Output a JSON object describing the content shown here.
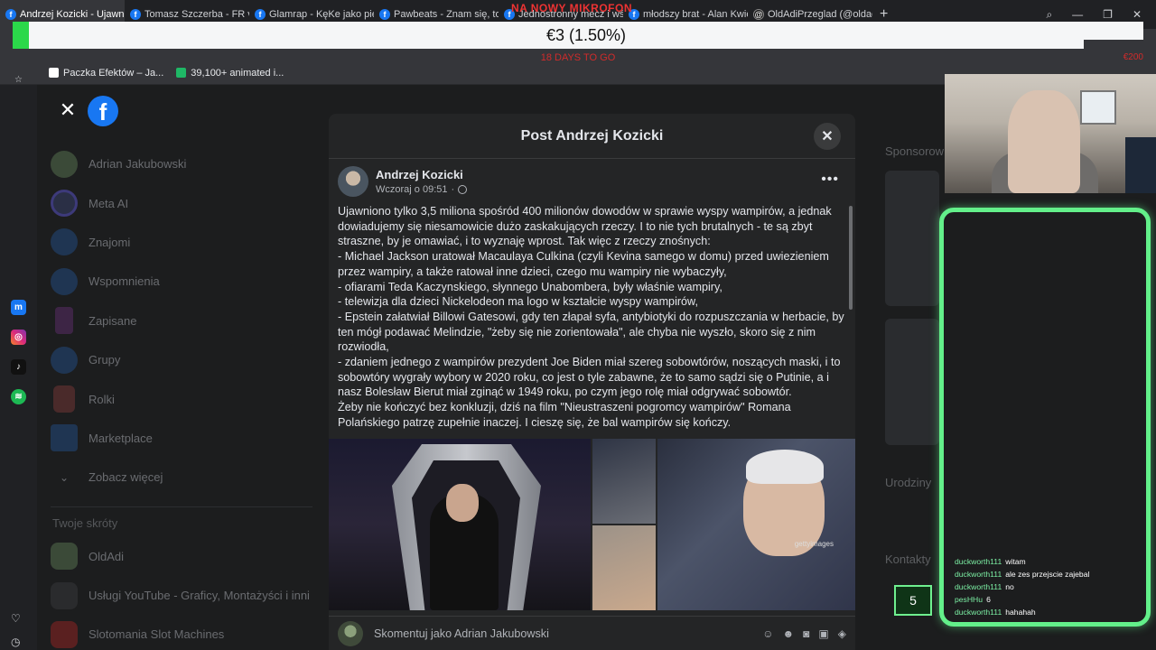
{
  "browser": {
    "tabs": [
      {
        "label": "Andrzej Kozicki - Ujawnio",
        "active": true
      },
      {
        "label": "Tomasz Szczerba - FR vs",
        "active": false
      },
      {
        "label": "Glamrap - KęKe jako pierw",
        "active": false
      },
      {
        "label": "Pawbeats - Znam się, to",
        "active": false
      },
      {
        "label": "Jednostronny mecz i wści",
        "active": false
      },
      {
        "label": "młodszy brat - Alan Kwiec",
        "active": false
      },
      {
        "label": "OldAdiPrzeglad (@oldadi",
        "active": false
      }
    ],
    "new_tab": "+",
    "window_controls": [
      "search",
      "minimize",
      "restore",
      "close"
    ],
    "bookmarks": [
      {
        "label": "Paczka Efektów – Ja...",
        "color": "#ffffff"
      },
      {
        "label": "39,100+ animated i...",
        "color": "#1fb866"
      }
    ]
  },
  "overlay": {
    "mic_title": "NA NOWY MIKROFON",
    "donation_amount": "€3 (1.50%)",
    "days_to_go": "18 DAYS TO GO",
    "side_amount": "€200",
    "accent_color": "#2bd84a"
  },
  "rail": {
    "icons": [
      "messenger-icon",
      "instagram-icon",
      "tiktok-icon",
      "spotify-icon"
    ],
    "bottom_icons": [
      "heart-icon",
      "history-icon"
    ]
  },
  "facebook": {
    "sidebar": {
      "items": [
        {
          "label": "Adrian Jakubowski",
          "icon": "profile-avatar"
        },
        {
          "label": "Meta AI",
          "icon": "meta-ai-icon"
        },
        {
          "label": "Znajomi",
          "icon": "friends-icon"
        },
        {
          "label": "Wspomnienia",
          "icon": "memories-icon"
        },
        {
          "label": "Zapisane",
          "icon": "saved-icon"
        },
        {
          "label": "Grupy",
          "icon": "groups-icon"
        },
        {
          "label": "Rolki",
          "icon": "reels-icon"
        },
        {
          "label": "Marketplace",
          "icon": "marketplace-icon"
        },
        {
          "label": "Zobacz więcej",
          "icon": "chevron-down-icon"
        }
      ],
      "shortcuts_title": "Twoje skróty",
      "shortcuts": [
        {
          "label": "OldAdi"
        },
        {
          "label": "Usługi YouTube - Graficy, Montażyści i inni"
        },
        {
          "label": "Slotomania Slot Machines"
        }
      ]
    },
    "right_column": {
      "sponsored_title": "Sponsorow",
      "birthdays_title": "Urodziny",
      "contacts_title": "Kontakty"
    },
    "modal": {
      "title": "Post Andrzej Kozicki",
      "author": "Andrzej Kozicki",
      "timestamp": "Wczoraj o 09:51",
      "more": "•••",
      "paragraphs": [
        "Ujawniono tylko 3,5 miliona spośród 400 milionów dowodów w sprawie wyspy wampirów, a jednak dowiadujemy się niesamowicie dużo zaskakujących rzeczy. I to nie tych brutalnych - te są zbyt straszne, by je omawiać, i to wyznaję wprost. Tak więc z rzeczy znośnych:",
        "- Michael Jackson uratował Macaulaya Culkina (czyli Kevina samego w domu) przed uwiezieniem przez wampiry, a także ratował inne dzieci, czego mu wampiry nie wybaczyły,",
        "- ofiarami Teda Kaczynskiego, słynnego Unabombera, były właśnie wampiry,",
        "- telewizja dla dzieci Nickelodeon ma logo w kształcie wyspy wampirów,",
        "- Epstein załatwiał Billowi Gatesowi, gdy ten złapał syfa, antybiotyki do rozpuszczania w herbacie, by ten mógł podawać Melindzie, \"żeby się nie zorientowała\", ale chyba nie wyszło, skoro się z nim rozwiodła,",
        "- zdaniem jednego z wampirów prezydent Joe Biden miał szereg sobowtórów, noszących maski, i to sobowtóry wygrały wybory w 2020 roku, co jest o tyle zabawne, że to samo sądzi się o Putinie, a i nasz Bolesław Bierut miał zginąć w 1949 roku, po czym jego rolę miał odgrywać sobowtór.",
        "Żeby nie kończyć bez konkluzji, dziś na film \"Nieustraszeni pogromcy wampirów\" Romana Polańskiego patrzę zupełnie inaczej. I cieszę się, że bal wampirów się kończy."
      ],
      "image_watermark": "gettyimages",
      "comment_placeholder": "Skomentuj jako Adrian Jakubowski",
      "comment_icons": [
        "avatar-icon",
        "emoji-icon",
        "camera-icon",
        "gif-icon",
        "sticker-icon"
      ]
    }
  },
  "chat": {
    "messages": [
      {
        "user": "duckworth111",
        "text": "witam"
      },
      {
        "user": "duckworth111",
        "text": "ale zes przejscie zajebal"
      },
      {
        "user": "duckworth111",
        "text": "no"
      },
      {
        "user": "pesHHu",
        "text": "6"
      },
      {
        "user": "duckworth111",
        "text": "hahahah"
      }
    ],
    "badge_value": "5",
    "border_color": "#63f08a"
  }
}
